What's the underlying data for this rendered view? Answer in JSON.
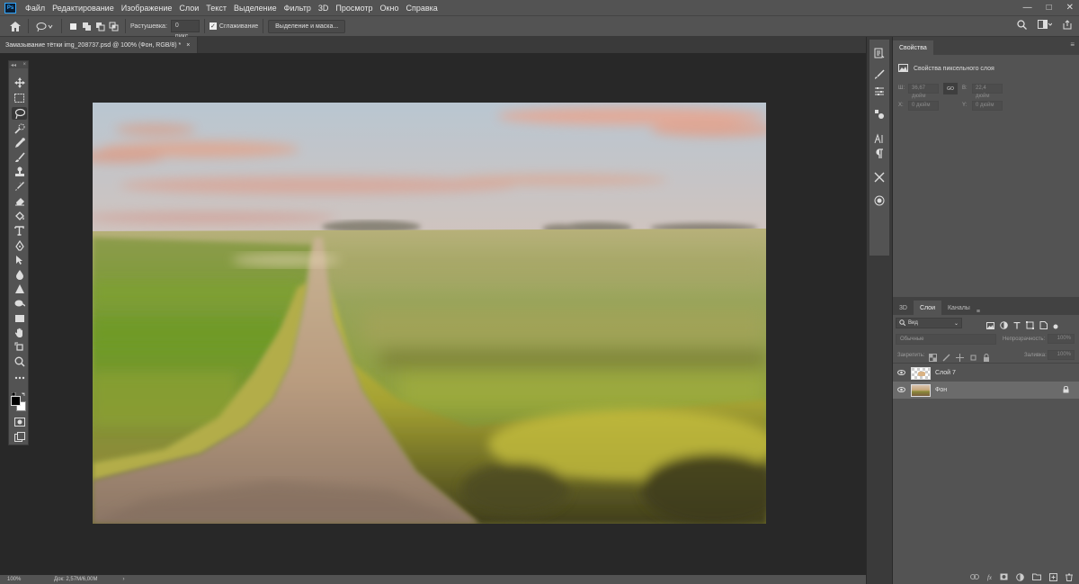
{
  "menubar": {
    "logo": "Ps",
    "items": [
      "Файл",
      "Редактирование",
      "Изображение",
      "Слои",
      "Текст",
      "Выделение",
      "Фильтр",
      "3D",
      "Просмотр",
      "Окно",
      "Справка"
    ],
    "controls": {
      "minimize": "—",
      "maximize": "□",
      "close": "✕"
    }
  },
  "options": {
    "feather_label": "Растушевка:",
    "feather_value": "0 пикс.",
    "antialias_label": "Сглаживание",
    "select_mask_button": "Выделение и маска..."
  },
  "document": {
    "tab_title": "Замазывание тётки img_208737.psd @ 100% (Фон, RGB/8) *",
    "close": "×"
  },
  "toolbar": {
    "collapse": "◂◂",
    "close": "×"
  },
  "status": {
    "zoom": "100%",
    "doc": "Док: 2,57M/6,00M",
    "arrow": "›"
  },
  "properties": {
    "tab": "Свойства",
    "type_label": "Свойства пиксельного слоя",
    "w_label": "Ш:",
    "w_value": "36,67 дюйм",
    "h_label": "В:",
    "h_value": "22,4 дюйм",
    "x_label": "X:",
    "x_value": "0 дюйм",
    "y_label": "Y:",
    "y_value": "0 дюйм",
    "link_icon": "GO"
  },
  "layers_panel": {
    "tabs": [
      "3D",
      "Слои",
      "Каналы"
    ],
    "active_tab": "Слои",
    "filter_kind": "Вид",
    "blend_mode": "Обычные",
    "opacity_label": "Непрозрачность:",
    "opacity_value": "100%",
    "lock_label": "Закрепить:",
    "fill_label": "Заливка:",
    "fill_value": "100%",
    "layers": [
      {
        "name": "Слой 7",
        "visible": true,
        "selected": false,
        "locked": false
      },
      {
        "name": "Фон",
        "visible": true,
        "selected": true,
        "locked": true
      }
    ]
  },
  "colors": {
    "ui_panel": "#535353",
    "ui_dark": "#282828",
    "accent": "#31a8ff"
  }
}
